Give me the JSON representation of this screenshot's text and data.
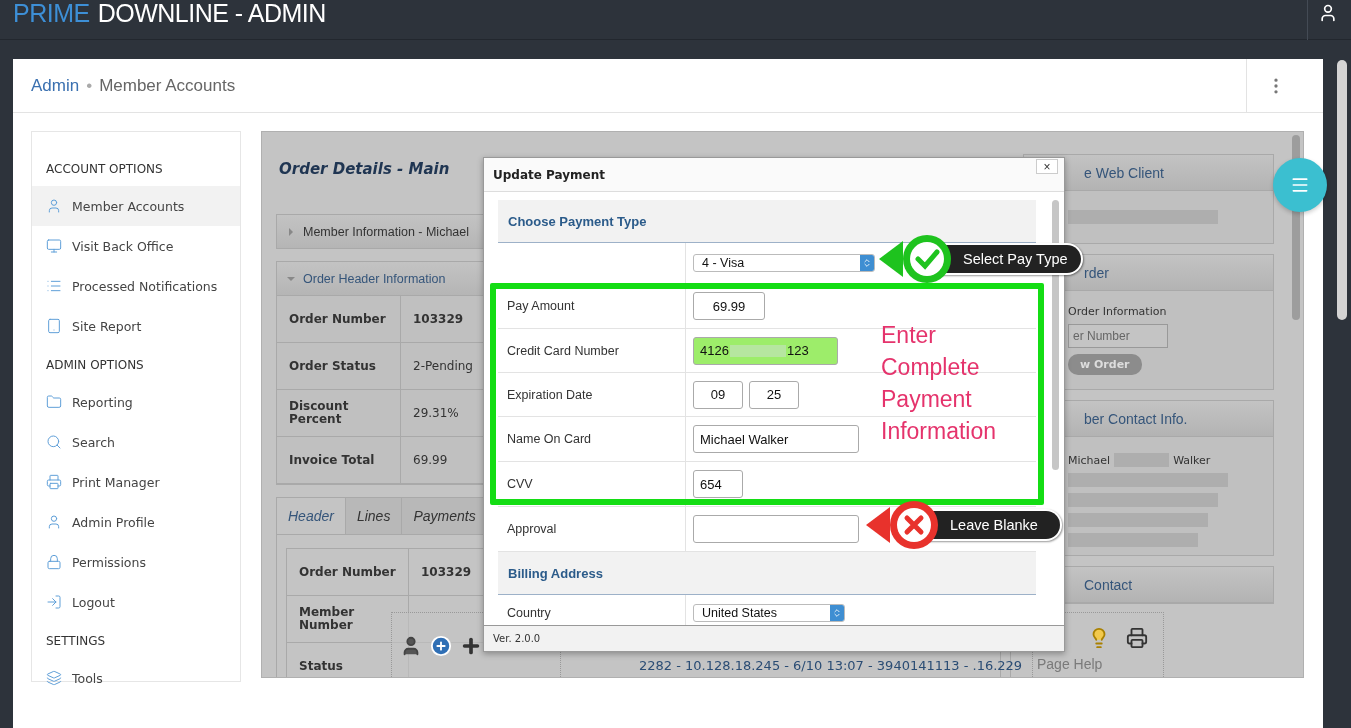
{
  "header": {
    "logo_primary": "PRIME",
    "logo_secondary": "DOWNLINE - ADMIN"
  },
  "breadcrumb": [
    {
      "label": "Admin",
      "kind": "link"
    },
    {
      "label": "•",
      "kind": "separator"
    },
    {
      "label": "Member Accounts",
      "kind": "current"
    }
  ],
  "sidebar": [
    {
      "title": "ACCOUNT OPTIONS",
      "items": [
        {
          "label": "Member Accounts",
          "selected": true
        },
        {
          "label": "Visit Back Office",
          "selected": false
        },
        {
          "label": "Processed Notifications",
          "selected": false
        },
        {
          "label": "Site Report",
          "selected": false
        }
      ]
    },
    {
      "title": "ADMIN OPTIONS",
      "items": [
        {
          "label": "Reporting",
          "selected": false
        },
        {
          "label": "Search",
          "selected": false
        },
        {
          "label": "Print Manager",
          "selected": false
        },
        {
          "label": "Admin Profile",
          "selected": false
        },
        {
          "label": "Permissions",
          "selected": false
        },
        {
          "label": "Logout",
          "selected": false
        }
      ]
    },
    {
      "title": "SETTINGS",
      "items": [
        {
          "label": "Tools",
          "selected": false
        }
      ]
    }
  ],
  "order": {
    "title": "Order Details - Main",
    "panels": [
      {
        "title": "Member Information - Michael",
        "expanded": false
      },
      {
        "title": "Order Header Information",
        "expanded": true,
        "rows": [
          {
            "label": "Order Number",
            "value": "103329",
            "strong": true
          },
          {
            "label": "Order Status",
            "value": "2-Pending",
            "strong": false
          },
          {
            "label": "Discount Percent",
            "value": "29.31%",
            "strong": false
          },
          {
            "label": "Invoice Total",
            "value": "69.99",
            "strong": false
          }
        ]
      }
    ],
    "tabs": [
      {
        "label": "Header",
        "selected": true
      },
      {
        "label": "Lines",
        "selected": false
      },
      {
        "label": "Payments",
        "selected": false
      }
    ],
    "tab_rows": [
      {
        "label": "Order Number",
        "value": "103329",
        "strong": true
      },
      {
        "label": "Member Number",
        "strong": false
      },
      {
        "label": "Status",
        "strong": false
      }
    ]
  },
  "side_panels": [
    {
      "title": "e Web Client",
      "kind": "blurred"
    },
    {
      "title": "rder",
      "kind": "lookup",
      "caption": "Order Information",
      "placeholder": "er Number",
      "button": "w Order"
    },
    {
      "title": "ber Contact Info.",
      "kind": "contact",
      "first_name": "Michael",
      "last_name": "Walker"
    },
    {
      "title": "Contact",
      "kind": "empty"
    }
  ],
  "footer": {
    "status": "2282 - 10.128.18.245 - 6/10 13:07 - 3940141113 - .16.229",
    "help": "Page Help"
  },
  "dialog": {
    "title": "Update Payment",
    "close": "×",
    "version": "Ver. 2.0.0",
    "rows": [
      {
        "kind": "section",
        "label": "Choose Payment Type"
      },
      {
        "kind": "select",
        "value": "4 - Visa"
      },
      {
        "kind": "amount",
        "label": "Pay Amount",
        "value": "69.99"
      },
      {
        "kind": "masked",
        "label": "Credit Card Number",
        "start": "4126",
        "end": "123"
      },
      {
        "kind": "pair",
        "label": "Expiration Date",
        "first": "09",
        "second": "25"
      },
      {
        "kind": "text",
        "label": "Name On Card",
        "value": "Michael Walker"
      },
      {
        "kind": "code",
        "label": "CVV",
        "value": "654"
      },
      {
        "kind": "text",
        "label": "Approval"
      },
      {
        "kind": "section",
        "label": "Billing Address"
      },
      {
        "kind": "select",
        "label": "Country",
        "value": "United States"
      }
    ]
  },
  "annotations": {
    "note": "Enter Complete Payment Information",
    "callouts": [
      {
        "kind": "confirm",
        "label": "Select Pay Type"
      },
      {
        "kind": "reject",
        "label": "Leave Blanke"
      }
    ]
  }
}
